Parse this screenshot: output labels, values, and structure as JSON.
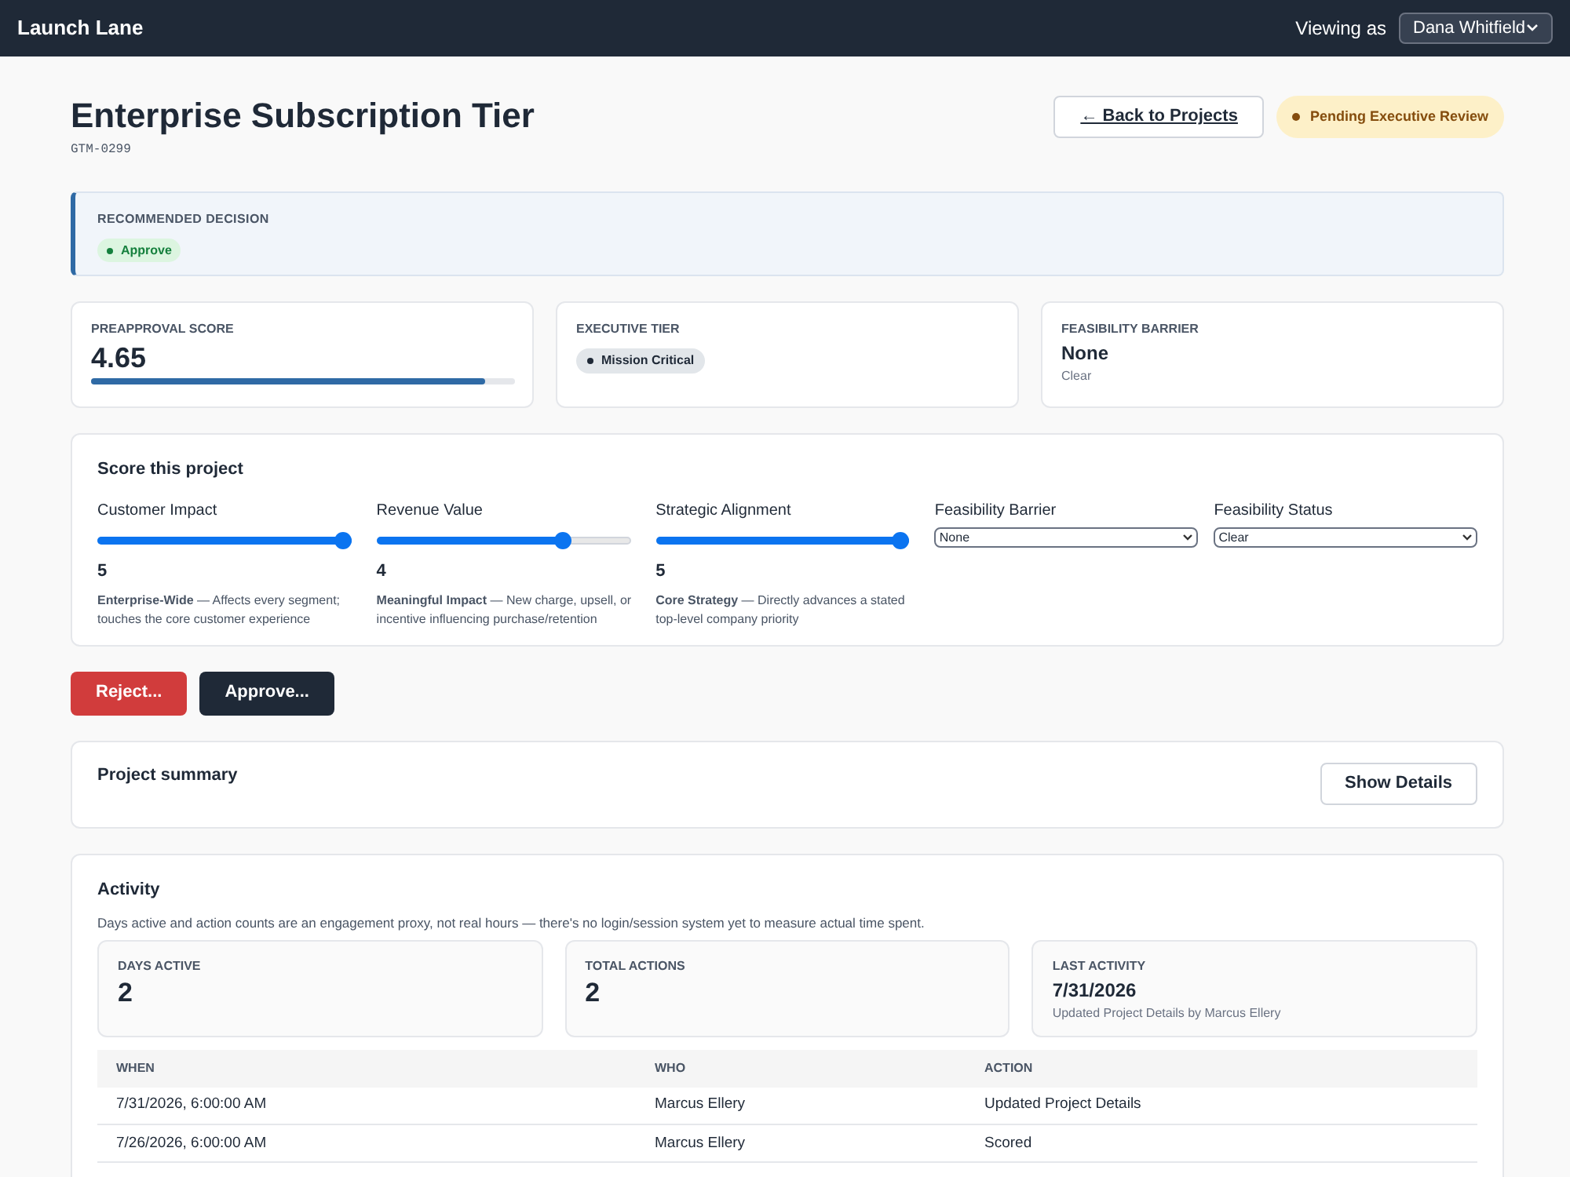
{
  "app": {
    "name": "Launch Lane",
    "viewing_label": "Viewing as",
    "viewer": "Dana Whitfield"
  },
  "project": {
    "title": "Enterprise Subscription Tier",
    "code": "GTM-0299",
    "back": "← Back to Projects",
    "status": "Pending Executive Review"
  },
  "recommendation": {
    "label": "RECOMMENDED DECISION",
    "decision": "Approve"
  },
  "stats": [
    {
      "kind": "score",
      "label": "PREAPPROVAL SCORE",
      "value": "4.65",
      "level": 0.93
    },
    {
      "kind": "tag",
      "label": "EXECUTIVE TIER",
      "value": "Mission Critical"
    },
    {
      "kind": "text",
      "label": "FEASIBILITY BARRIER",
      "value": "None",
      "sub": "Clear"
    }
  ],
  "scoring": {
    "title": "Score this project",
    "sliders": [
      {
        "label": "Customer Impact",
        "level": 1.0,
        "value": "5",
        "desc": "**Enterprise-Wide** — Affects every segment; touches the core customer experience"
      },
      {
        "label": "Revenue Value",
        "level": 0.75,
        "value": "4",
        "desc": "**Meaningful Impact** — New charge, upsell, or incentive influencing purchase/retention"
      },
      {
        "label": "Strategic Alignment",
        "level": 1.0,
        "value": "5",
        "desc": "**Core Strategy** — Directly advances a stated top-level company priority"
      }
    ],
    "selects": [
      {
        "label": "Feasibility Barrier",
        "value": "None"
      },
      {
        "label": "Feasibility Status",
        "value": "Clear"
      }
    ]
  },
  "actions": [
    {
      "kind": "danger",
      "label": "Reject..."
    },
    {
      "kind": "primary",
      "label": "Approve..."
    }
  ],
  "summary": {
    "title": "Project summary",
    "button": "Show Details"
  },
  "activity": {
    "title": "Activity",
    "note": "Days active and action counts are an engagement proxy, not real hours — there's no login/session system yet to measure actual time spent.",
    "stats": [
      {
        "label": "DAYS ACTIVE",
        "value": "2"
      },
      {
        "label": "TOTAL ACTIONS",
        "value": "2"
      },
      {
        "label": "LAST ACTIVITY",
        "value": "7/31/2026",
        "sub": "Updated Project Details by Marcus Ellery"
      }
    ],
    "columns": [
      "WHEN",
      "WHO",
      "ACTION"
    ],
    "rows": [
      [
        "7/31/2026, 6:00:00 AM",
        "Marcus Ellery",
        "Updated Project Details"
      ],
      [
        "7/26/2026, 6:00:00 AM",
        "Marcus Ellery",
        "Scored"
      ]
    ]
  }
}
